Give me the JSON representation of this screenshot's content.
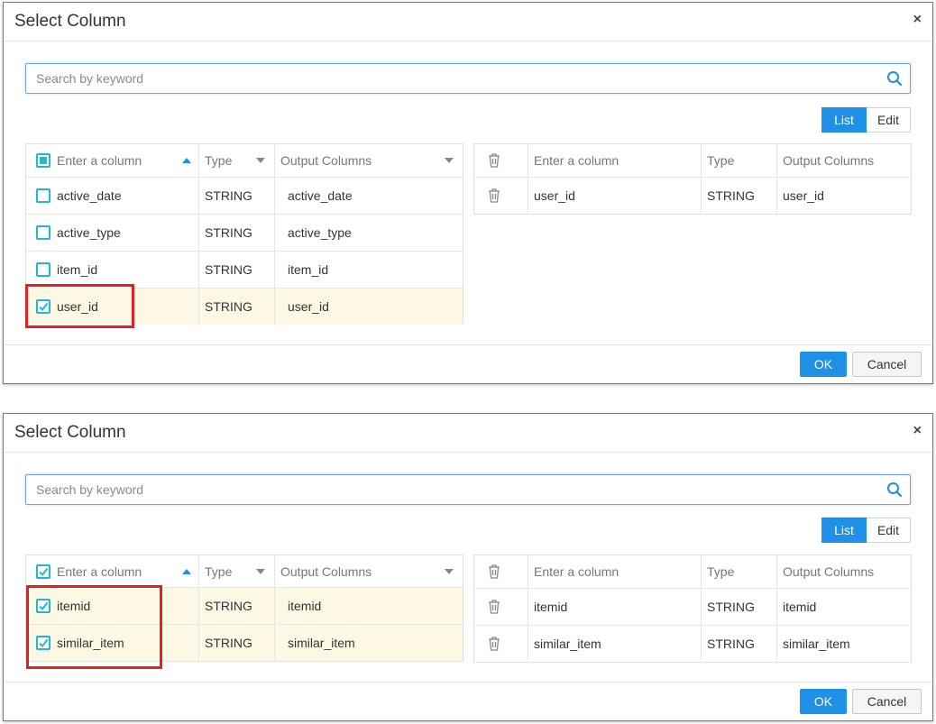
{
  "colors": {
    "accent": "#1e90e6",
    "checkbox": "#23b7d3",
    "selected_row": "#fcf8e3",
    "highlight": "#e32121"
  },
  "dialog_1": {
    "title": "Select Column",
    "close": "×",
    "search": {
      "placeholder": "Search by keyword",
      "value": ""
    },
    "view_toggle": {
      "list": "List",
      "edit": "Edit",
      "active": "List"
    },
    "left_grid": {
      "headers": {
        "column": "Enter a column",
        "type": "Type",
        "output": "Output Columns"
      },
      "header_checkbox": "partial",
      "rows": [
        {
          "name": "active_date",
          "type": "STRING",
          "output": "active_date",
          "checked": false
        },
        {
          "name": "active_type",
          "type": "STRING",
          "output": "active_type",
          "checked": false
        },
        {
          "name": "item_id",
          "type": "STRING",
          "output": "item_id",
          "checked": false
        },
        {
          "name": "user_id",
          "type": "STRING",
          "output": "user_id",
          "checked": true
        }
      ]
    },
    "right_grid": {
      "headers": {
        "column": "Enter a column",
        "type": "Type",
        "output": "Output Columns"
      },
      "rows": [
        {
          "name": "user_id",
          "type": "STRING",
          "output": "user_id"
        }
      ]
    },
    "footer": {
      "ok": "OK",
      "cancel": "Cancel"
    }
  },
  "dialog_2": {
    "title": "Select Column",
    "close": "×",
    "search": {
      "placeholder": "Search by keyword",
      "value": ""
    },
    "view_toggle": {
      "list": "List",
      "edit": "Edit",
      "active": "List"
    },
    "left_grid": {
      "headers": {
        "column": "Enter a column",
        "type": "Type",
        "output": "Output Columns"
      },
      "header_checkbox": "checked",
      "rows": [
        {
          "name": "itemid",
          "type": "STRING",
          "output": "itemid",
          "checked": true
        },
        {
          "name": "similar_item",
          "type": "STRING",
          "output": "similar_item",
          "checked": true
        }
      ]
    },
    "right_grid": {
      "headers": {
        "column": "Enter a column",
        "type": "Type",
        "output": "Output Columns"
      },
      "rows": [
        {
          "name": "itemid",
          "type": "STRING",
          "output": "itemid"
        },
        {
          "name": "similar_item",
          "type": "STRING",
          "output": "similar_item"
        }
      ]
    },
    "footer": {
      "ok": "OK",
      "cancel": "Cancel"
    }
  }
}
